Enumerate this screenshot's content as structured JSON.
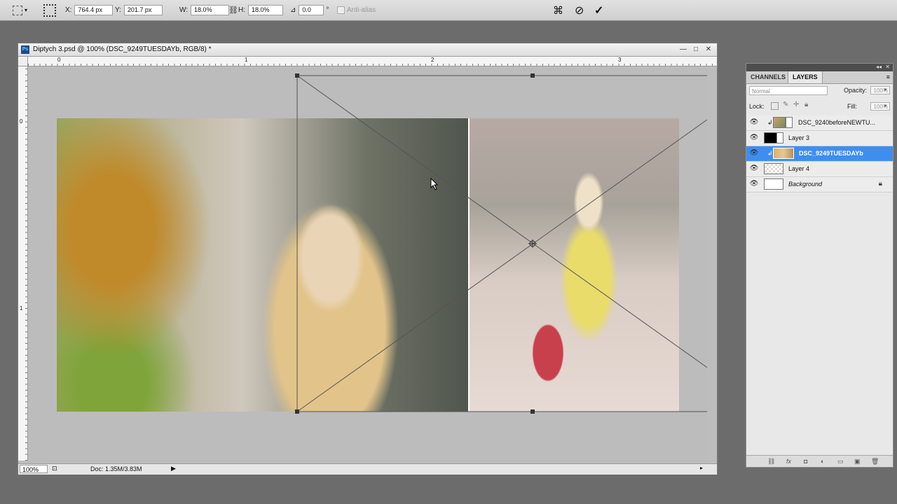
{
  "options_bar": {
    "x_label": "X:",
    "x_value": "764.4 px",
    "y_label": "Y:",
    "y_value": "201.7 px",
    "w_label": "W:",
    "w_value": "18.0%",
    "h_label": "H:",
    "h_value": "18.0%",
    "angle_value": "0.0",
    "degree": "°",
    "antialias_label": "Anti-alias"
  },
  "document": {
    "title": "Diptych 3.psd @ 100% (DSC_9249TUESDAYb, RGB/8) *",
    "ruler_h_labels": [
      "0",
      "1",
      "2",
      "3"
    ],
    "ruler_v_labels": [
      "0",
      "1"
    ],
    "zoom": "100%",
    "doc_size": "Doc: 1.35M/3.83M"
  },
  "panel": {
    "tabs": [
      "CHANNELS",
      "LAYERS"
    ],
    "active_tab": "LAYERS",
    "blend_mode": "Normal",
    "opacity_label": "Opacity:",
    "opacity_value": "100%",
    "lock_label": "Lock:",
    "fill_label": "Fill:",
    "fill_value": "100%",
    "layers": [
      {
        "name": "DSC_9240beforeNEWTU...",
        "selected": false
      },
      {
        "name": "Layer 3",
        "selected": false
      },
      {
        "name": "DSC_9249TUESDAYb",
        "selected": true
      },
      {
        "name": "Layer 4",
        "selected": false
      },
      {
        "name": "Background",
        "selected": false,
        "locked": true
      }
    ]
  },
  "colors": {
    "selection": "#3e8ef0",
    "workspace": "#6c6c6c"
  }
}
